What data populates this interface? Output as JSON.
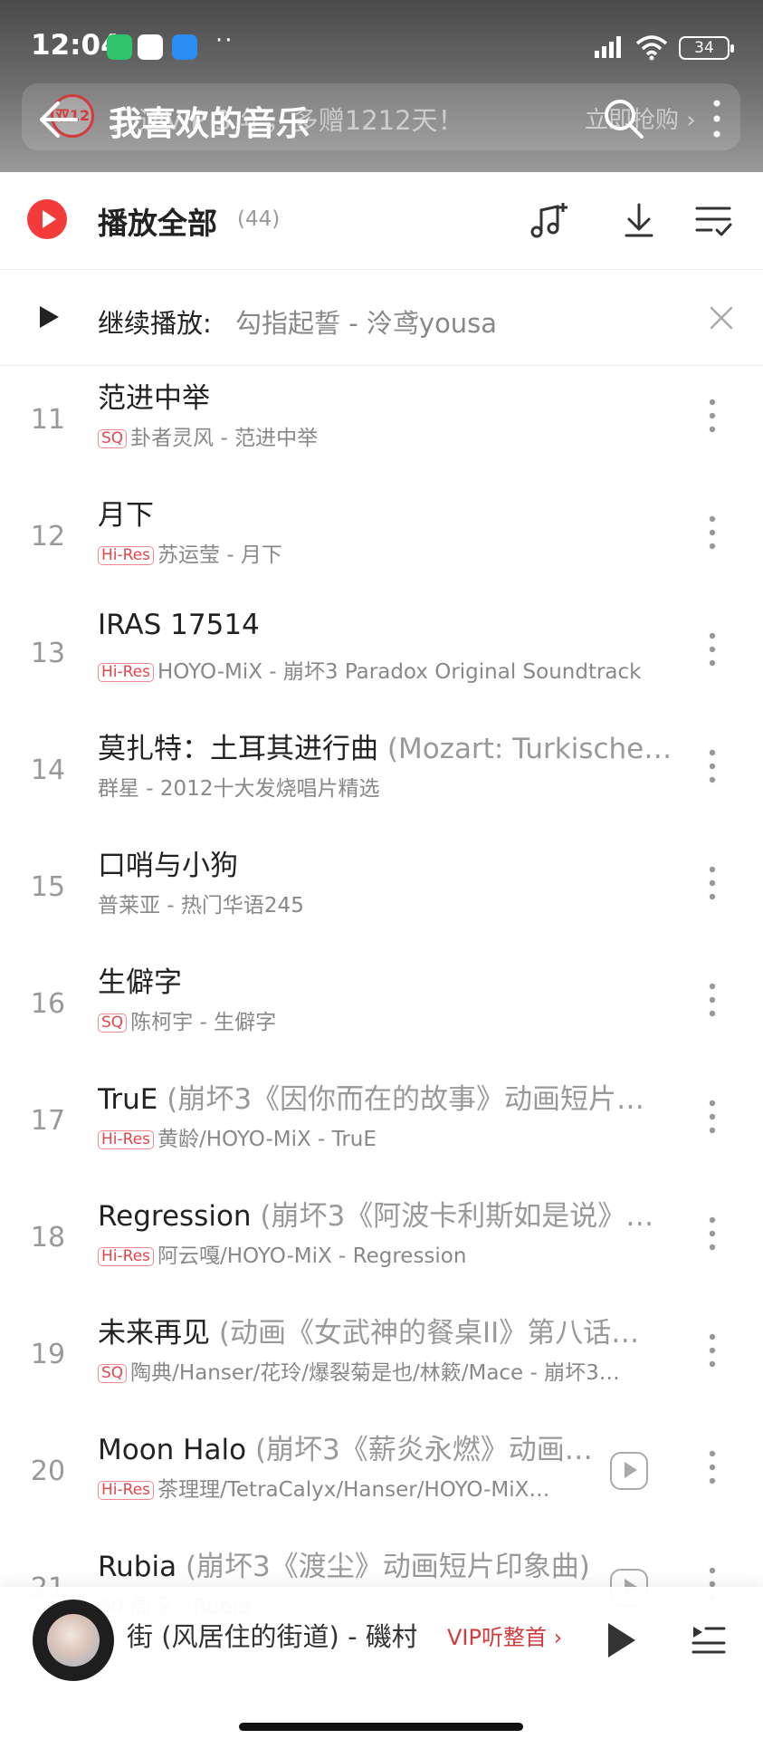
{
  "status_bar": {
    "time": "12:04",
    "dots": "··",
    "battery": "34"
  },
  "promo": {
    "logo": "双12",
    "text": "开通VIP 3 年，多赠1212天！",
    "cta": "立即抢购 ›"
  },
  "header": {
    "title": "我喜欢的音乐"
  },
  "play_all": {
    "label": "播放全部",
    "count": "(44)"
  },
  "resume": {
    "label": "继续播放:",
    "track": "勾指起誓 - 泠鸢yousa"
  },
  "songs": [
    {
      "index": "11",
      "title": "范进中举",
      "subtitle": "",
      "badge": "SQ",
      "meta": "卦者灵风 - 范进中举",
      "video": false
    },
    {
      "index": "12",
      "title": "月下",
      "subtitle": "",
      "badge": "Hi-Res",
      "meta": "苏运莹 - 月下",
      "video": false
    },
    {
      "index": "13",
      "title": "IRAS 17514",
      "subtitle": "",
      "badge": "Hi-Res",
      "meta": "HOYO-MiX - 崩坏3 Paradox Original Soundtrack",
      "video": false
    },
    {
      "index": "14",
      "title": "莫扎特：土耳其进行曲",
      "subtitle": "(Mozart: Turkische…",
      "badge": "",
      "meta": "群星 - 2012十大发烧唱片精选",
      "video": false
    },
    {
      "index": "15",
      "title": "口哨与小狗",
      "subtitle": "",
      "badge": "",
      "meta": "普莱亚 - 热门华语245",
      "video": false
    },
    {
      "index": "16",
      "title": "生僻字",
      "subtitle": "",
      "badge": "SQ",
      "meta": "陈柯宇 - 生僻字",
      "video": false
    },
    {
      "index": "17",
      "title": "TruE",
      "subtitle": "(崩坏3《因你而在的故事》动画短片…",
      "badge": "Hi-Res",
      "meta": "黄龄/HOYO-MiX - TruE",
      "video": false
    },
    {
      "index": "18",
      "title": "Regression",
      "subtitle": "(崩坏3《阿波卡利斯如是说》…",
      "badge": "Hi-Res",
      "meta": "阿云嘎/HOYO-MiX - Regression",
      "video": false
    },
    {
      "index": "19",
      "title": "未来再见",
      "subtitle": "(动画《女武神的餐桌II》第八话…",
      "badge": "SQ",
      "meta": "陶典/Hanser/花玲/爆裂菊是也/林簌/Mace - 崩坏3…",
      "video": false
    },
    {
      "index": "20",
      "title": "Moon Halo",
      "subtitle": "(崩坏3《薪炎永燃》动画…",
      "badge": "Hi-Res",
      "meta": "茶理理/TetraCalyx/Hanser/HOYO-MiX…",
      "video": true
    },
    {
      "index": "21",
      "title": "Rubia",
      "subtitle": "(崩坏3《渡尘》动画短片印象曲)",
      "badge": "SQ",
      "meta": "周深 - Rubia",
      "video": true
    }
  ],
  "player": {
    "now_playing": "街 (风居住的街道) - 磯村",
    "vip": "VIP听整首 ›"
  },
  "colors": {
    "accent": "#f33b3b",
    "badge": "#e3444d",
    "header_top": "#4a4a4a"
  }
}
